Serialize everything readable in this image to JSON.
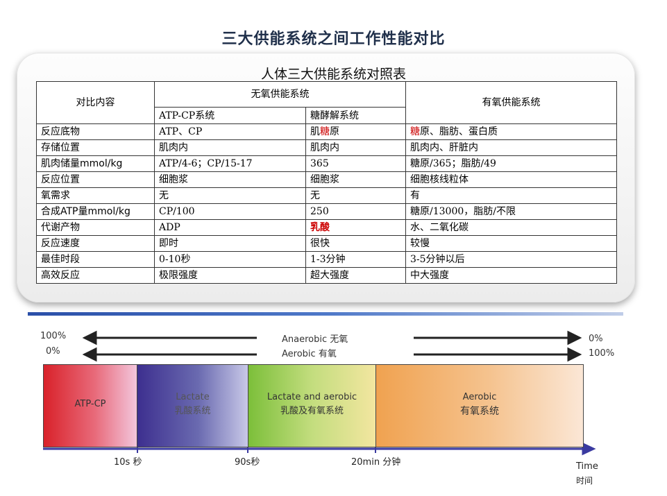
{
  "page_title": "三大供能系统之间工作性能对比",
  "table": {
    "title": "人体三大供能系统对照表",
    "header": {
      "compare": "对比内容",
      "anaerobic": "无氧供能系统",
      "aerobic": "有氧供能系统",
      "atp_cp": "ATP-CP系统",
      "glycolysis": "糖酵解系统"
    },
    "rows": [
      {
        "item": "反应底物",
        "atp": "ATP、CP",
        "gly_a": "肌",
        "gly_b": "糖",
        "gly_c": "原",
        "aer_a": "糖",
        "aer_b": "原、脂肪、蛋白质"
      },
      {
        "item": "存储位置",
        "atp": "肌肉内",
        "gly": "肌肉内",
        "aer": "肌肉内、肝脏内"
      },
      {
        "item": "肌肉储量mmol/kg",
        "atp": "ATP/4-6；CP/15-17",
        "gly": "365",
        "aer": "糖原/365；脂肪/49"
      },
      {
        "item": "反应位置",
        "atp": "细胞浆",
        "gly": "细胞浆",
        "aer": "细胞核线粒体"
      },
      {
        "item": "氧需求",
        "atp": "无",
        "gly": "无",
        "aer": "有"
      },
      {
        "item": "合成ATP量mmol/kg",
        "atp": "CP/100",
        "gly": "250",
        "aer": "糖原/13000，脂肪/不限"
      },
      {
        "item": "代谢产物",
        "atp": "ADP",
        "gly": "乳酸",
        "aer": "水、二氧化碳"
      },
      {
        "item": "反应速度",
        "atp": "即时",
        "gly": "很快",
        "aer": "较慢"
      },
      {
        "item": "最佳时段",
        "atp": "0-10秒",
        "gly": "1-3分钟",
        "aer": "3-5分钟以后"
      },
      {
        "item": "高效反应",
        "atp": "极限强度",
        "gly": "超大强度",
        "aer": "中大强度"
      }
    ]
  },
  "diagram": {
    "anaerobic_label": "Anaerobic 无氧",
    "aerobic_label": "Aerobic 有氧",
    "left_top_pct": "100%",
    "left_bottom_pct": "0%",
    "right_top_pct": "0%",
    "right_bottom_pct": "100%",
    "segments": [
      {
        "line1": "ATP-CP",
        "line2": ""
      },
      {
        "line1": "Lactate",
        "line2": "乳酸系统"
      },
      {
        "line1": "Lactate and aerobic",
        "line2": "乳酸及有氧系统"
      },
      {
        "line1": "Aerobic",
        "line2": "有氧系统"
      }
    ],
    "ticks": [
      "10s 秒",
      "90s秒",
      "20min 分钟"
    ],
    "time_label_en": "Time",
    "time_label_zh": "时间",
    "colors": {
      "atp": "#d9222a",
      "lactate": "#3d2f8f",
      "mixed": "#7cbf3a",
      "aerobic": "#f0a250"
    }
  }
}
